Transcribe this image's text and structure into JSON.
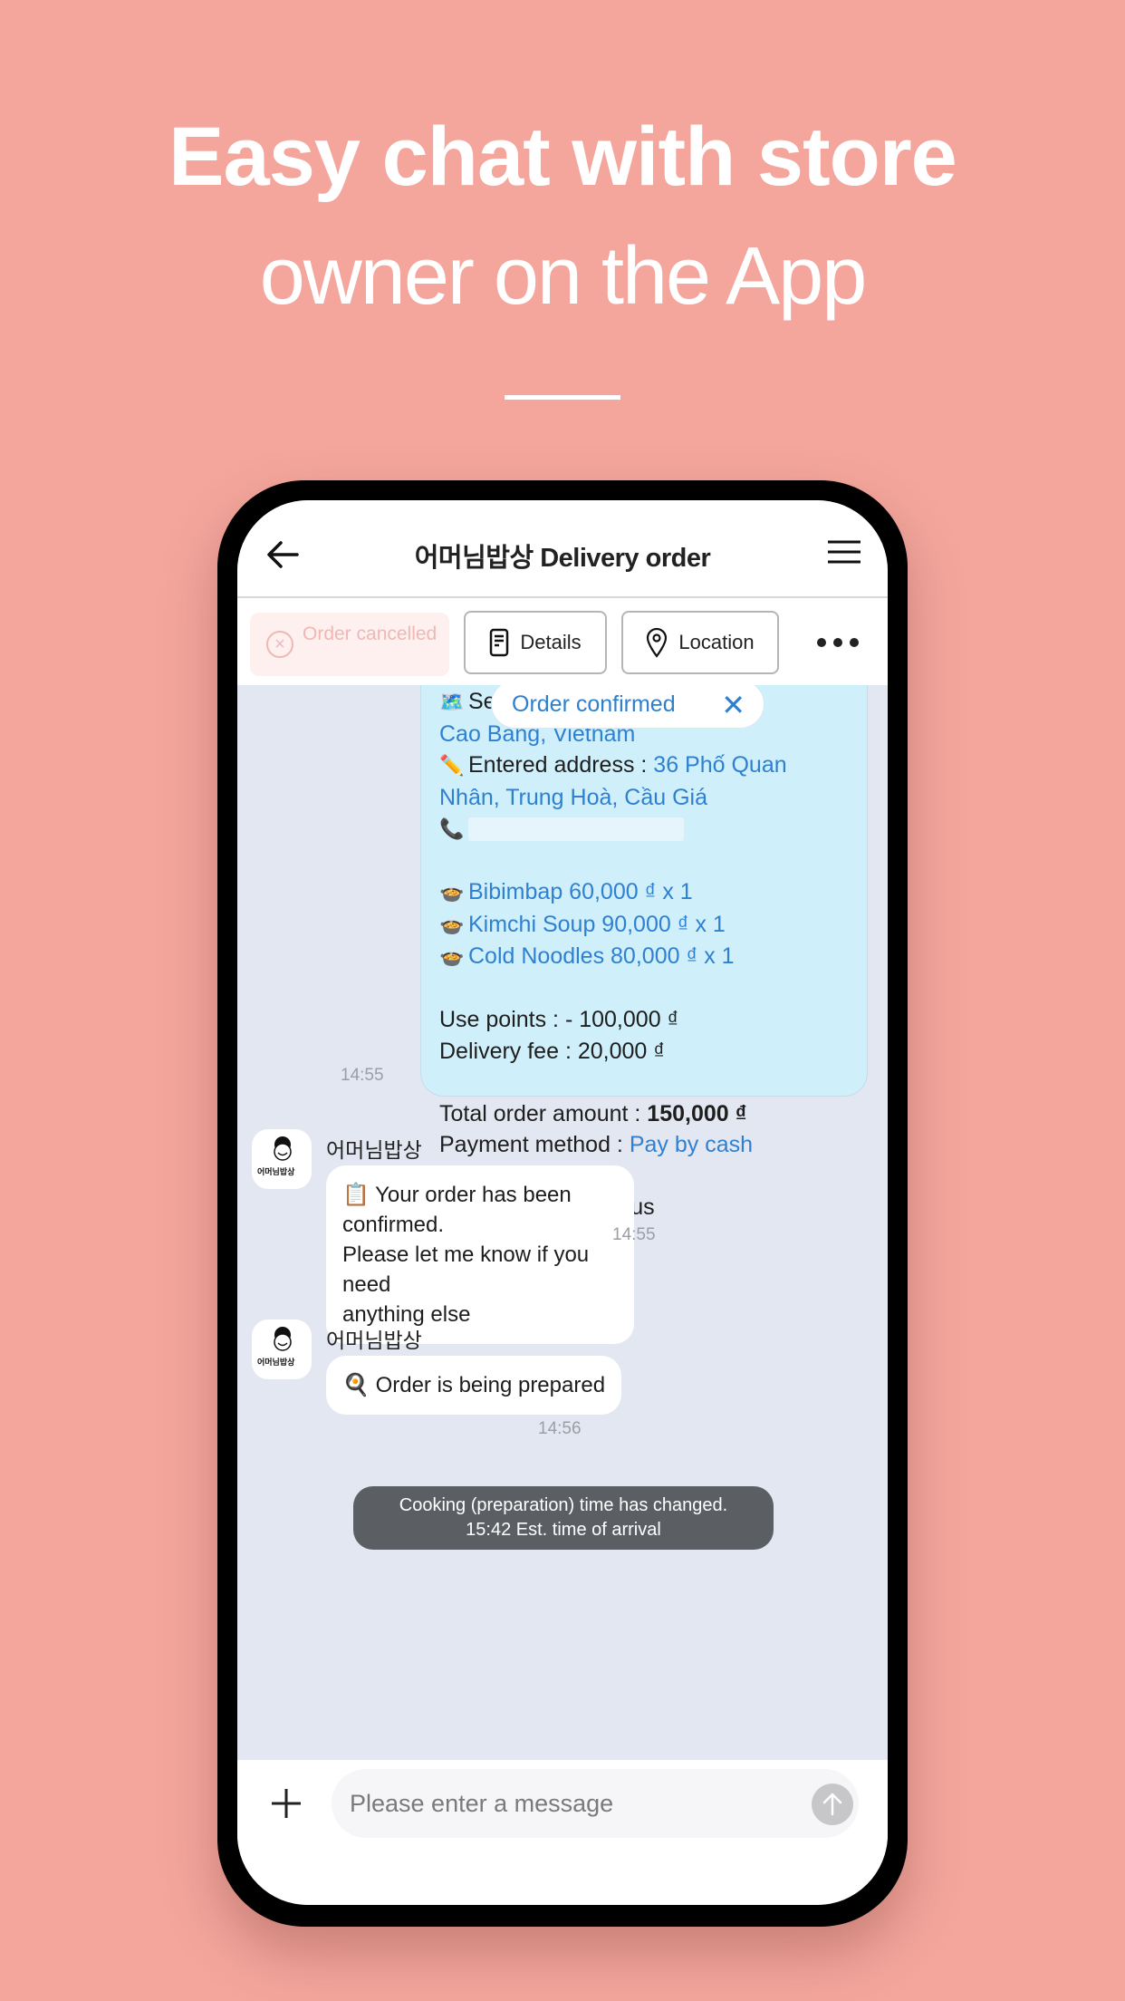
{
  "hero": {
    "line1": "Easy chat with store",
    "line2": "owner on the App"
  },
  "header": {
    "title": "어머님밥상 Delivery order",
    "back_icon": "arrow-left-icon",
    "menu_icon": "hamburger-menu-icon"
  },
  "action_bar": {
    "cancel_label": "Order cancelled",
    "details_label": "Details",
    "location_label": "Location",
    "more_icon": "more-horizontal-icon"
  },
  "order_message": {
    "selected_address_label": "Selected a",
    "selected_address_value": "Cao Bang, Vietnam",
    "entered_address_label": "Entered address : ",
    "entered_address_value_1": "36 Phố Quan",
    "entered_address_value_2": "Nhân, Trung Hoà, Cầu Giá",
    "items": [
      "Bibimbap 60,000 ₫ x 1",
      "Kimchi Soup 90,000 ₫ x 1",
      "Cold Noodles 80,000 ₫ x 1"
    ],
    "use_points": "Use points : - 100,000 ₫",
    "delivery_fee": "Delivery fee : 20,000 ₫",
    "total_label": "Total order amount : ",
    "total_value": "150,000 ₫",
    "payment_label": "Payment method : ",
    "payment_value": "Pay by cash",
    "request": "Please deliver it to us",
    "time": "14:55"
  },
  "confirmed_pill": {
    "label": "Order confirmed",
    "close": "✕"
  },
  "messages": [
    {
      "sender": "어머님밥상",
      "emoji": "📋",
      "text_1": "Your order has been confirmed.",
      "text_2": "Please let me know if you need",
      "text_3": "anything else",
      "time": "14:55"
    },
    {
      "sender": "어머님밥상",
      "emoji": "🍳",
      "text_1": "Order is being prepared",
      "time": "14:56"
    }
  ],
  "avatar_brand": "어머님밥상",
  "system_notice": {
    "line1": "Cooking (preparation) time has changed.",
    "line2": "15:42 Est. time of arrival"
  },
  "input": {
    "placeholder": "Please enter a message"
  },
  "colors": {
    "background": "#f4a69c",
    "accent_blue": "#2f80d0",
    "order_bubble": "#cfeffb",
    "chat_bg": "#e3e7f1"
  }
}
